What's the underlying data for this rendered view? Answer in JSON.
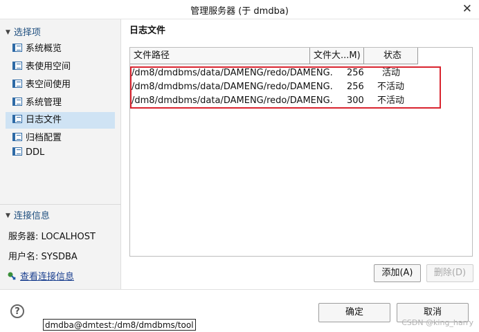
{
  "window": {
    "title": "管理服务器 (于 dmdba)",
    "close_glyph": "✕"
  },
  "sidebar": {
    "section_options": "选择项",
    "items": [
      {
        "label": "系统概览"
      },
      {
        "label": "表使用空间"
      },
      {
        "label": "表空间使用"
      },
      {
        "label": "系统管理"
      },
      {
        "label": "日志文件",
        "selected": true
      },
      {
        "label": "归档配置"
      },
      {
        "label": "DDL"
      }
    ],
    "section_connection": "连接信息",
    "server_line": "服务器: LOCALHOST",
    "user_line": "用户名: SYSDBA",
    "view_link": "查看连接信息"
  },
  "main": {
    "title": "日志文件",
    "columns": [
      "文件路径",
      "文件大...M)",
      "状态"
    ],
    "rows": [
      {
        "path": "/dm8/dmdbms/data/DAMENG/redo/DAMENG.",
        "size": "256",
        "status": "活动"
      },
      {
        "path": "/dm8/dmdbms/data/DAMENG/redo/DAMENG.",
        "size": "256",
        "status": "不活动"
      },
      {
        "path": "/dm8/dmdbms/data/DAMENG/redo/DAMENG.",
        "size": "300",
        "status": "不活动"
      }
    ],
    "add_button": "添加(A)",
    "delete_button": "删除(D)"
  },
  "footer": {
    "help_glyph": "?",
    "ok_button": "确定",
    "cancel_button": "取消",
    "path_label": "dmdba@dmtest:/dm8/dmdbms/tool",
    "watermark": "CSDN @king_harry"
  },
  "colors": {
    "selection": "#cfe3f4",
    "highlight_box": "#d9232e",
    "link": "#1a3f8f"
  }
}
